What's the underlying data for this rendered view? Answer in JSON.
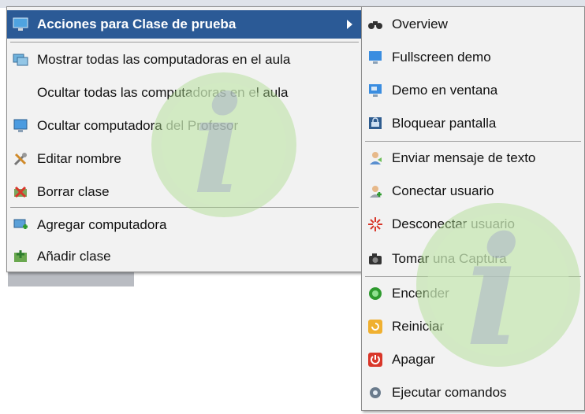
{
  "left_menu": {
    "header": "Acciones para Clase de prueba",
    "items": [
      {
        "label": "Mostrar todas las computadoras en el aula",
        "icon": "monitors-icon"
      },
      {
        "label": "Ocultar todas las computadoras en el aula",
        "icon": ""
      },
      {
        "label": "Ocultar computadora del Profesor",
        "icon": "monitor-icon"
      },
      {
        "label": "Editar nombre",
        "icon": "tools-icon"
      },
      {
        "label": "Borrar clase",
        "icon": "delete-class-icon"
      },
      {
        "label": "Agregar computadora",
        "icon": "add-computer-icon"
      },
      {
        "label": "Añadir clase",
        "icon": "add-class-icon"
      }
    ]
  },
  "right_menu": {
    "items": [
      {
        "label": "Overview",
        "icon": "binoculars-icon"
      },
      {
        "label": "Fullscreen demo",
        "icon": "fullscreen-demo-icon"
      },
      {
        "label": "Demo en ventana",
        "icon": "window-demo-icon"
      },
      {
        "label": "Bloquear pantalla",
        "icon": "lock-screen-icon"
      },
      {
        "label": "Enviar mensaje de texto",
        "icon": "message-icon"
      },
      {
        "label": "Conectar usuario",
        "icon": "connect-user-icon"
      },
      {
        "label": "Desconectar usuario",
        "icon": "disconnect-user-icon"
      },
      {
        "label": "Tomar una Captura",
        "icon": "camera-icon"
      },
      {
        "label": "Encender",
        "icon": "power-on-icon"
      },
      {
        "label": "Reiniciar",
        "icon": "restart-icon"
      },
      {
        "label": "Apagar",
        "icon": "power-off-icon"
      },
      {
        "label": "Ejecutar comandos",
        "icon": "gear-icon"
      }
    ]
  },
  "colors": {
    "highlight": "#2b5a96",
    "menu_bg": "#f2f2f2"
  }
}
